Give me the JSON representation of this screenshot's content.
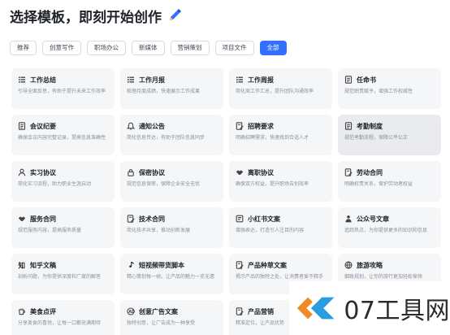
{
  "header": {
    "title": "选择模板，即刻开始创作",
    "title_icon": "pen-icon"
  },
  "filters": [
    {
      "label": "推荐",
      "active": false
    },
    {
      "label": "创意写作",
      "active": false
    },
    {
      "label": "职场办公",
      "active": false
    },
    {
      "label": "新媒体",
      "active": false
    },
    {
      "label": "营销策划",
      "active": false
    },
    {
      "label": "项目文件",
      "active": false
    },
    {
      "label": "全部",
      "active": true
    }
  ],
  "cards": [
    {
      "icon": "list-icon",
      "title": "工作总结",
      "desc": "引导全面反思，有助于提升未来工作效率"
    },
    {
      "icon": "list-icon",
      "title": "工作月报",
      "desc": "梳理月度成绩，快速展示工作成果"
    },
    {
      "icon": "list-icon",
      "title": "工作周报",
      "desc": "简化周工作汇总，提升团队沟通效率"
    },
    {
      "icon": "document-icon",
      "title": "任命书",
      "desc": "规范职责赋予，增强工作权威性"
    },
    {
      "icon": "document-icon",
      "title": "会议纪要",
      "desc": "确保会议内容完整记录，提高信息准确性"
    },
    {
      "icon": "bell-icon",
      "title": "通知公告",
      "desc": "简化信息传达，有助于团队信息同步"
    },
    {
      "icon": "document-edit-icon",
      "title": "招聘要求",
      "desc": "明确招聘需求，快速找到合适人才"
    },
    {
      "icon": "document-icon",
      "title": "考勤制度",
      "desc": "规范考勤流程，保障公平公正"
    },
    {
      "icon": "user-icon",
      "title": "实习协议",
      "desc": "简化实习流程，助力职业生涯启动"
    },
    {
      "icon": "lock-icon",
      "title": "保密协议",
      "desc": "规范信息保密，保障企业安全无忧"
    },
    {
      "icon": "handshake-icon",
      "title": "离职协议",
      "desc": "确保双方权益，提升职场告别效率"
    },
    {
      "icon": "document-edit-icon",
      "title": "劳动合同",
      "desc": "明确权责关系，保护劳动者权益"
    },
    {
      "icon": "handshake-icon",
      "title": "服务合同",
      "desc": "规范服务内容，提高服务质量"
    },
    {
      "icon": "document-edit-icon",
      "title": "技术合同",
      "desc": "简化技术共享，推动创新发展"
    },
    {
      "icon": "book-icon",
      "title": "小红书文案",
      "desc": "增强表达，打造引人注目的内容"
    },
    {
      "icon": "person-icon",
      "title": "公众号文章",
      "desc": "追踪热点，为你提供更多的知识和信息"
    },
    {
      "icon": "zhi-icon",
      "title": "知乎文稿",
      "desc": "剖析问题，为你提供深度和广度的解答"
    },
    {
      "icon": "music-icon",
      "title": "短视频带货脚本",
      "desc": "精心策划每一帧，让产品的魅力一览无遗"
    },
    {
      "icon": "document-edit-icon",
      "title": "产品种草文案",
      "desc": "揭示产品的独特之处，让消费者爱不释手"
    },
    {
      "icon": "globe-icon",
      "title": "旅游攻略",
      "desc": "细致规划，让你的旅行更加轻松愉快"
    },
    {
      "icon": "cup-icon",
      "title": "美食点评",
      "desc": "分享美食的喜悦，让每一口都充满期待"
    },
    {
      "icon": "ad-icon",
      "title": "创意广告文案",
      "desc": "独特创意，让广告成为一种享受"
    },
    {
      "icon": "document-edit-icon",
      "title": "产品营销",
      "desc": "精准定位，让产品优势"
    },
    {
      "icon": "blank-icon",
      "title": "",
      "desc": ""
    }
  ],
  "watermark": {
    "text": "07工具网"
  },
  "colors": {
    "accent": "#3370ff",
    "card_bg": "#f5f6f8",
    "card_hover_bg": "#e9ebee",
    "text": "#1f2329",
    "muted": "#8a9099"
  }
}
